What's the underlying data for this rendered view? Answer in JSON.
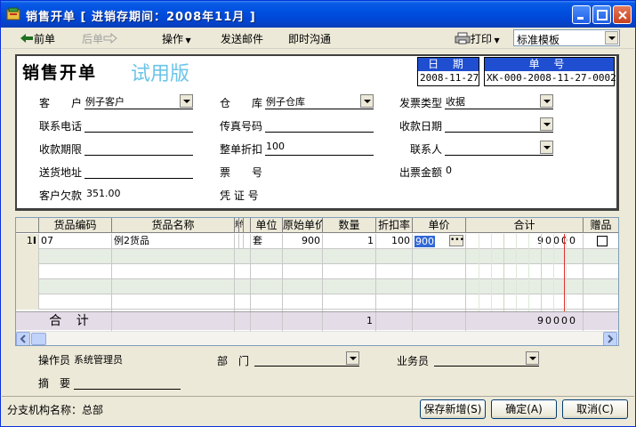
{
  "window": {
    "title": "销售开单  [ 进销存期间：2008年11月 ]"
  },
  "toolbar": {
    "prev_label": "前单",
    "next_label": "后单",
    "operate_label": "操作",
    "send_mail_label": "发送邮件",
    "chat_label": "即时沟通",
    "print_label": "打印",
    "template_value": "标准模板"
  },
  "header": {
    "doc_title": "销售开单",
    "trial_label": "试用版",
    "date_caption": "日 期",
    "date_value": "2008-11-27",
    "number_caption": "单 号",
    "number_value": "XK-000-2008-11-27-0002"
  },
  "form": {
    "customer_label": "客　　户",
    "customer_value": "例子客户",
    "warehouse_label": "仓　　库",
    "warehouse_value": "例子仓库",
    "invoice_type_label": "发票类型",
    "invoice_type_value": "收据",
    "phone_label": "联系电话",
    "fax_label": "传真号码",
    "receive_date_label": "收款日期",
    "receive_term_label": "收款期限",
    "discount_label": "整单折扣",
    "discount_value": "100",
    "contact_label": "联系人",
    "address_label": "送货地址",
    "ticket_label": "票　　号",
    "invoice_amount_label": "出票金额",
    "invoice_amount_value": "0",
    "debt_label": "客户欠款",
    "debt_value": "351.00",
    "voucher_label": "凭 证 号"
  },
  "grid": {
    "headers": {
      "code": "货品编码",
      "name": "货品名称",
      "spec": "规",
      "spec2": "件",
      "unit": "单位",
      "orig_price": "原始单价",
      "qty": "数量",
      "discount": "折扣率",
      "price": "单价",
      "total": "合计",
      "gift": "赠品"
    },
    "rows": [
      {
        "index": "1",
        "code": "07",
        "name": "例2货品",
        "unit": "套",
        "orig_price": "900",
        "qty": "1",
        "discount": "100",
        "price": "900",
        "total": "90000"
      }
    ],
    "total_label": "合 计",
    "total_qty": "1",
    "total_amount": "90000"
  },
  "footer": {
    "operator_label": "操作员",
    "operator_value": "系统管理员",
    "department_label": "部　门",
    "salesman_label": "业务员",
    "memo_label": "摘　要",
    "branch_label": "分支机构名称：总部",
    "save_new_label": "保存新增(S)",
    "ok_label": "确定(A)",
    "cancel_label": "取消(C)"
  }
}
